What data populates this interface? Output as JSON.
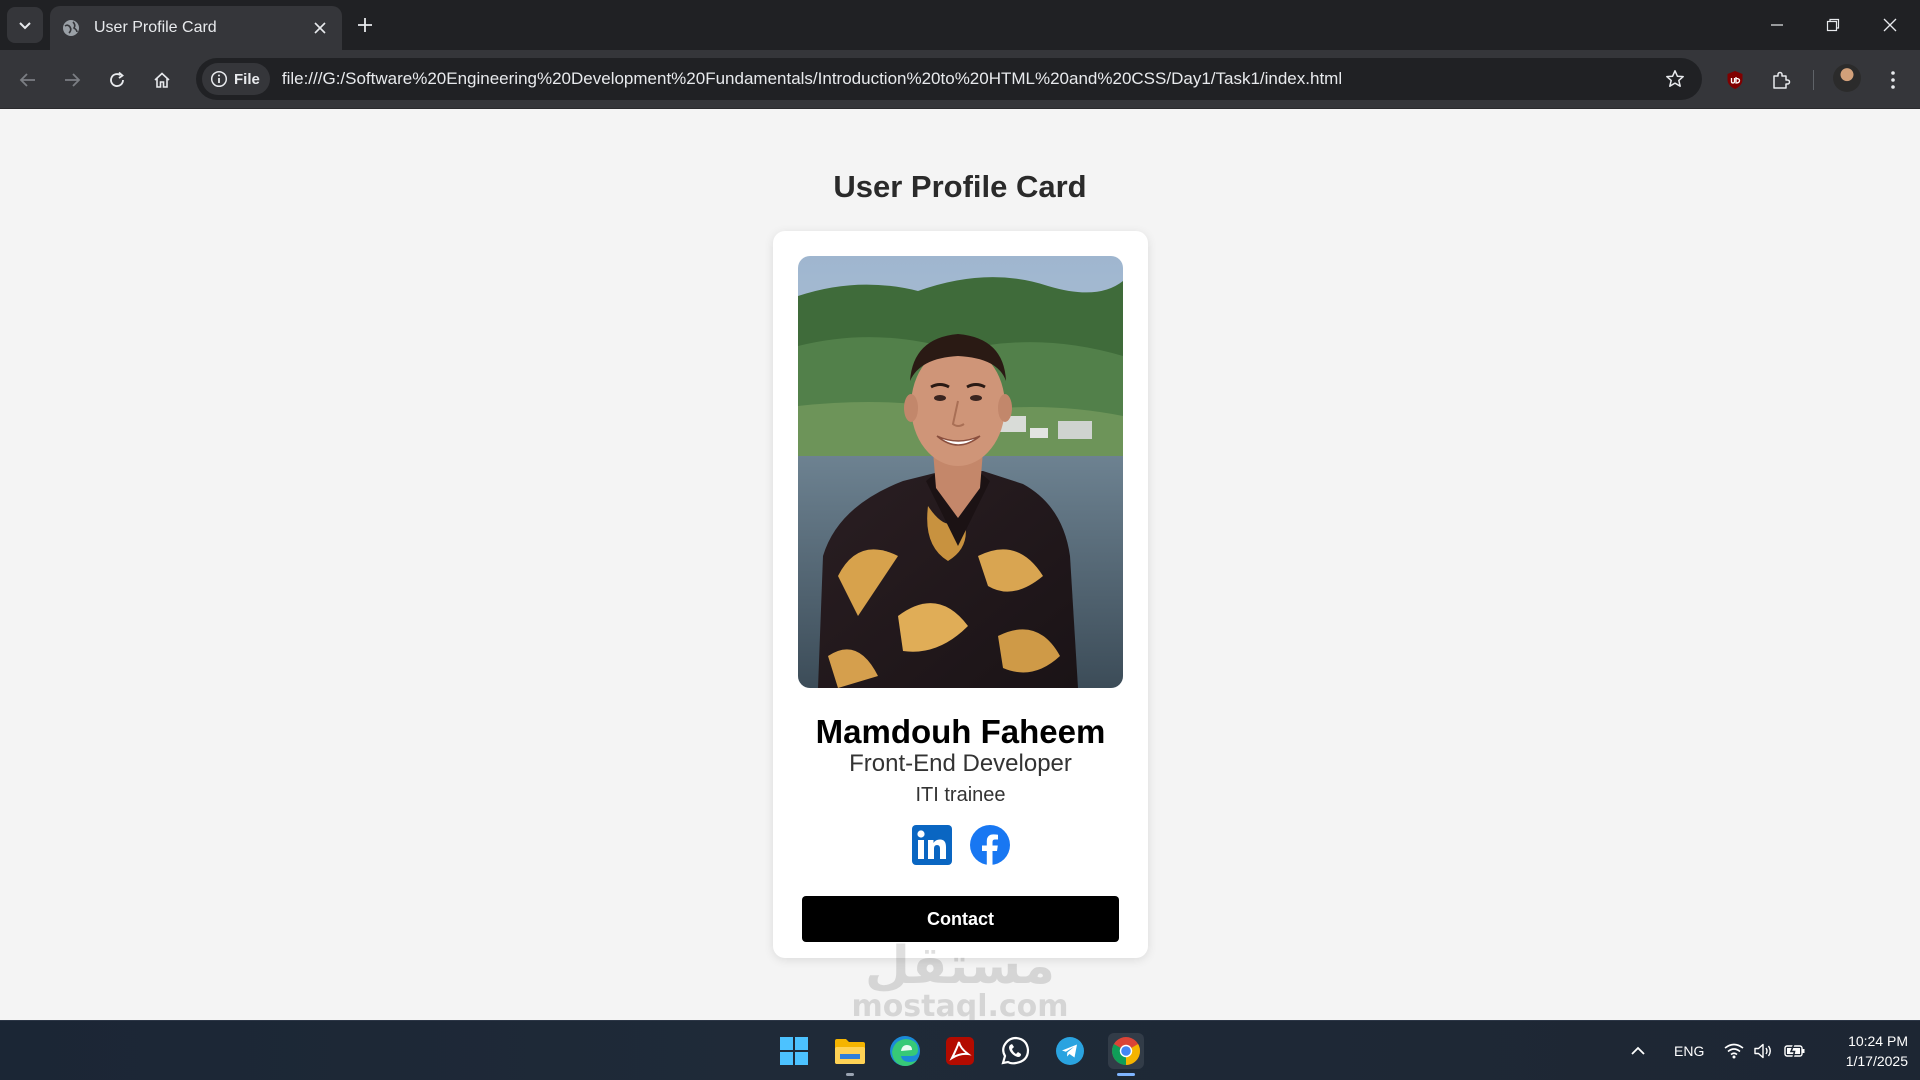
{
  "browser": {
    "tab_title": "User Profile Card",
    "site_chip": "File",
    "url": "file:///G:/Software%20Engineering%20Development%20Fundamentals/Introduction%20to%20HTML%20and%20CSS/Day1/Task1/index.html"
  },
  "page": {
    "title": "User Profile Card"
  },
  "card": {
    "name": "Mamdouh Faheem",
    "role": "Front-End Developer",
    "organization": "ITI trainee",
    "contact_label": "Contact",
    "socials": [
      "linkedin-icon",
      "facebook-icon"
    ]
  },
  "watermark": {
    "arabic": "مستقل",
    "latin": "mostaql.com"
  },
  "taskbar": {
    "language": "ENG",
    "time": "10:24 PM",
    "date": "1/17/2025"
  },
  "colors": {
    "chrome_dark": "#202124",
    "chrome_toolbar": "#35363a",
    "page_bg": "#f4f4f4",
    "button_bg": "#000000",
    "linkedin": "#0a66c2",
    "facebook": "#1877f2"
  }
}
